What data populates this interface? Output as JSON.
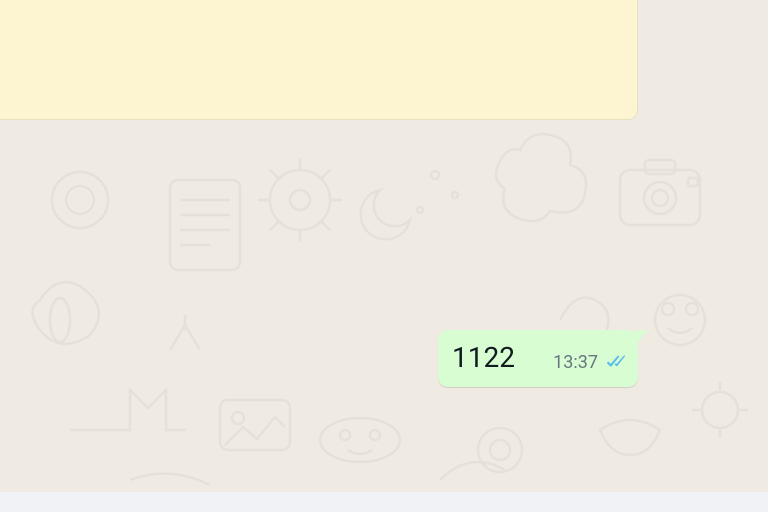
{
  "messages": {
    "outgoing": {
      "text": "1122",
      "time": "13:37",
      "status": "read"
    }
  },
  "colors": {
    "chat_bg": "#efeae2",
    "system_bg": "#fdf4d1",
    "outgoing_bg": "#d9fdd3",
    "tick_read": "#53bdeb",
    "time_color": "#667781",
    "text_color": "#111b21"
  }
}
